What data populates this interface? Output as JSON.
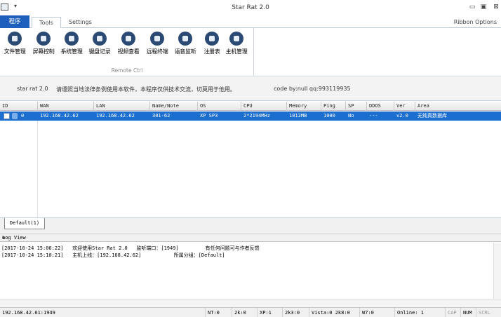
{
  "window": {
    "title": "Star Rat 2.0"
  },
  "ribbon": {
    "file_tab": "程序",
    "tabs": [
      "Tools",
      "Settings"
    ],
    "options": "Ribbon Options",
    "buttons": [
      "文件管理",
      "屏幕控制",
      "系统管理",
      "键盘记录",
      "视频查看",
      "远程终端",
      "语音监听",
      "注册表",
      "主机管理"
    ],
    "group_label": "Remote Ctrl"
  },
  "notice": {
    "version": "star rat 2.0",
    "message": "请遵照当地法律条例使用本软件，本程序仅供技术交流，切莫用于他用。",
    "author": "code by:null qq:993119935"
  },
  "grid": {
    "columns": [
      "ID",
      "WAN",
      "LAN",
      "Name/Note",
      "OS",
      "CPU",
      "Memory",
      "Ping",
      "SP",
      "DDOS",
      "Ver",
      "Area"
    ],
    "rows": [
      {
        "id": "0",
        "wan": "192.168.42.62",
        "lan": "192.168.42.62",
        "name": "301-62",
        "os": "XP SP3",
        "cpu": "2*2194MHz",
        "memory": "1012MB",
        "ping": "1000",
        "sp": "No",
        "ddos": "---",
        "ver": "v2.0",
        "area": "无纯真数据库"
      }
    ]
  },
  "group_tab": "Default(1)",
  "log": {
    "title": "Log View",
    "lines": [
      "[2017-10-24 15:06:22]   欢迎使用Star Rat 2.0   监听端口：[1949]         有任何问题可与作者反馈",
      "[2017-10-24 15:10:21]   主机上线：[192.168.42.62]           所属分组：[Default]"
    ]
  },
  "status": {
    "address": "192.168.42.61:1949",
    "nt": "NT:0",
    "w2k": "2k:0",
    "xp": "XP:1",
    "k3": "2k3:0",
    "vista": "Vista:0 2k8:0",
    "w7": "W7:0",
    "online": "Online: 1",
    "cap": "CAP",
    "num": "NUM",
    "scrl": "SCRL"
  }
}
